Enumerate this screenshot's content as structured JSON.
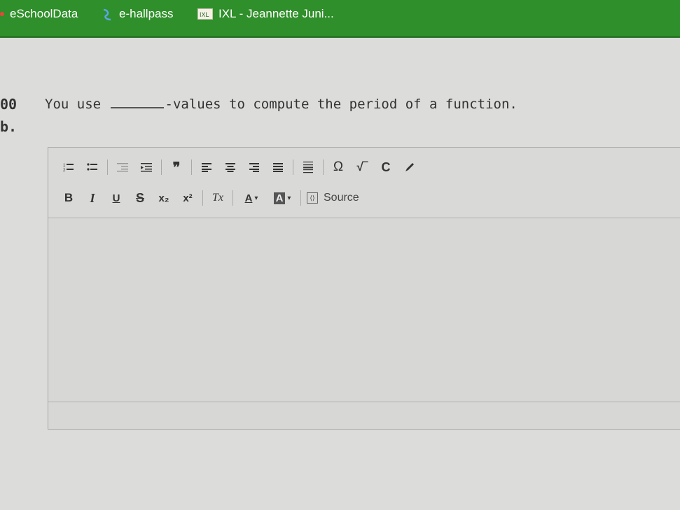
{
  "bookmarks": [
    {
      "label": "eSchoolData",
      "icon": "dot-icon"
    },
    {
      "label": "e-hallpass",
      "icon": "hallpass-icon"
    },
    {
      "label": "IXL - Jeannette Juni...",
      "icon": "ixl-icon"
    }
  ],
  "question": {
    "number": "00",
    "letter": "b.",
    "text_before": "You use",
    "text_after": "-values to compute the period of a function."
  },
  "editor": {
    "toolbar_row1": [
      "numbered-list-icon",
      "bulleted-list-icon",
      "decrease-indent-icon",
      "increase-indent-icon",
      "blockquote-icon",
      "align-left-icon",
      "align-center-icon",
      "align-right-icon",
      "justify-icon",
      "horizontal-line-icon",
      "special-character-icon",
      "math-icon",
      "chemistry-icon",
      "draw-icon"
    ],
    "toolbar_row2": {
      "bold": "B",
      "italic": "I",
      "underline": "U",
      "strike": "S",
      "subscript": "x₂",
      "superscript": "x²",
      "clear_format": "Tx",
      "text_color": "A",
      "bg_color": "A",
      "source": "Source"
    },
    "content": ""
  },
  "colors": {
    "bookmark_bar": "#2f8f2a",
    "page_bg": "#dcdcda"
  }
}
